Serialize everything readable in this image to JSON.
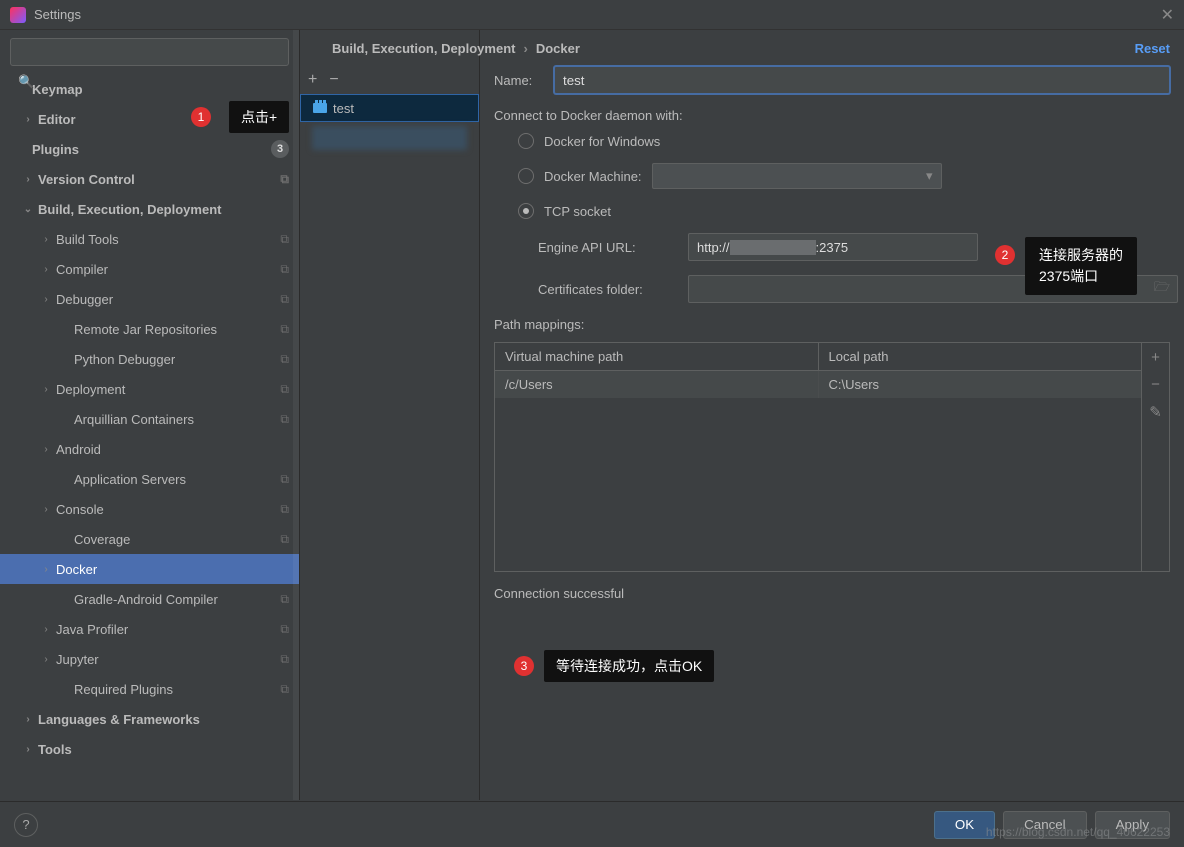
{
  "window": {
    "title": "Settings"
  },
  "search": {
    "placeholder": ""
  },
  "reset": "Reset",
  "breadcrumb": {
    "parent": "Build, Execution, Deployment",
    "current": "Docker"
  },
  "sidebar": {
    "items": [
      {
        "label": "Keymap",
        "level": "plpad",
        "bold": true
      },
      {
        "label": "Editor",
        "level": "pl1",
        "bold": true,
        "chev": "›"
      },
      {
        "label": "Plugins",
        "level": "plpad",
        "bold": true,
        "badge": "3"
      },
      {
        "label": "Version Control",
        "level": "pl1",
        "bold": true,
        "chev": "›",
        "copy": true
      },
      {
        "label": "Build, Execution, Deployment",
        "level": "pl1",
        "bold": true,
        "chev": "⌄"
      },
      {
        "label": "Build Tools",
        "level": "pl2",
        "chev": "›",
        "copy": true
      },
      {
        "label": "Compiler",
        "level": "pl2",
        "chev": "›",
        "copy": true
      },
      {
        "label": "Debugger",
        "level": "pl2",
        "chev": "›",
        "copy": true
      },
      {
        "label": "Remote Jar Repositories",
        "level": "pl3",
        "copy": true
      },
      {
        "label": "Python Debugger",
        "level": "pl3",
        "copy": true
      },
      {
        "label": "Deployment",
        "level": "pl2",
        "chev": "›",
        "copy": true
      },
      {
        "label": "Arquillian Containers",
        "level": "pl3",
        "copy": true
      },
      {
        "label": "Android",
        "level": "pl2",
        "chev": "›"
      },
      {
        "label": "Application Servers",
        "level": "pl3",
        "copy": true
      },
      {
        "label": "Console",
        "level": "pl2",
        "chev": "›",
        "copy": true
      },
      {
        "label": "Coverage",
        "level": "pl3",
        "copy": true
      },
      {
        "label": "Docker",
        "level": "pl2",
        "chev": "›",
        "selected": true
      },
      {
        "label": "Gradle-Android Compiler",
        "level": "pl3",
        "copy": true
      },
      {
        "label": "Java Profiler",
        "level": "pl2",
        "chev": "›",
        "copy": true
      },
      {
        "label": "Jupyter",
        "level": "pl2",
        "chev": "›",
        "copy": true
      },
      {
        "label": "Required Plugins",
        "level": "pl3",
        "copy": true
      },
      {
        "label": "Languages & Frameworks",
        "level": "pl1",
        "bold": true,
        "chev": "›"
      },
      {
        "label": "Tools",
        "level": "pl1",
        "bold": true,
        "chev": "›"
      }
    ]
  },
  "docker_list": {
    "item": "test"
  },
  "form": {
    "name_label": "Name:",
    "name_value": "test",
    "connect_label": "Connect to Docker daemon with:",
    "opt_windows": "Docker for Windows",
    "opt_machine": "Docker Machine:",
    "opt_tcp": "TCP socket",
    "engine_label": "Engine API URL:",
    "engine_prefix": "http://",
    "engine_suffix": ":2375",
    "cert_label": "Certificates folder:",
    "path_label": "Path mappings:",
    "col_vm": "Virtual machine path",
    "col_local": "Local path",
    "row_vm": "/c/Users",
    "row_local": "C:\\Users",
    "status": "Connection successful"
  },
  "callouts": {
    "c1": "点击+",
    "c2_l1": "连接服务器的",
    "c2_l2": "2375端口",
    "c3": "等待连接成功，点击OK"
  },
  "footer": {
    "ok": "OK",
    "cancel": "Cancel",
    "apply": "Apply",
    "help": "?"
  },
  "watermark": "https://blog.csdn.net/qq_40622253"
}
